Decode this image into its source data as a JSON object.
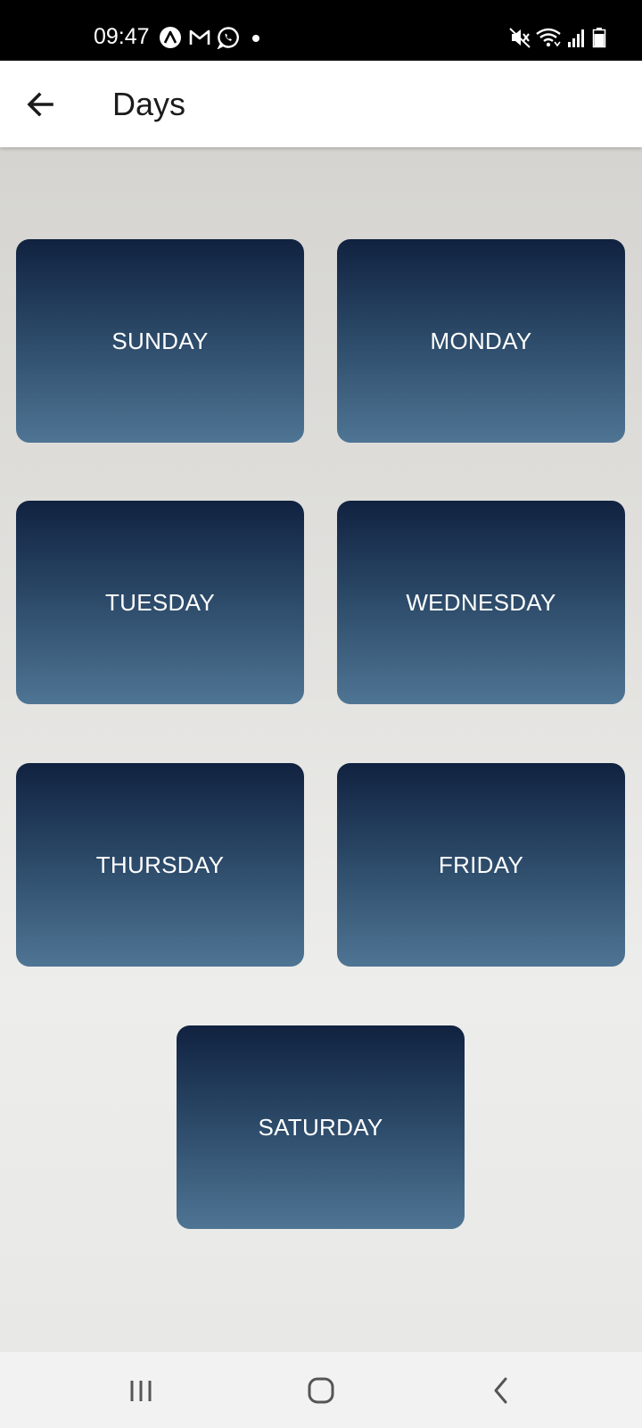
{
  "status_bar": {
    "time": "09:47",
    "icons": [
      "autopilot-icon",
      "gmail-icon",
      "whatsapp-icon",
      "notification-dot-icon",
      "mute-icon",
      "wifi-icon",
      "signal-icon",
      "battery-icon"
    ]
  },
  "app_bar": {
    "title": "Days",
    "back_icon": "arrow-back-icon"
  },
  "days": [
    {
      "label": "SUNDAY"
    },
    {
      "label": "MONDAY"
    },
    {
      "label": "TUESDAY"
    },
    {
      "label": "WEDNESDAY"
    },
    {
      "label": "THURSDAY"
    },
    {
      "label": "FRIDAY"
    },
    {
      "label": "SATURDAY"
    }
  ],
  "colors": {
    "card_top": "#102240",
    "card_bottom": "#4f7594",
    "background_top": "#d5d4d0",
    "background_bottom": "#e8e8e6",
    "app_bar": "#ffffff",
    "status_bar": "#000000"
  },
  "nav_bar": {
    "icons": [
      "recents-icon",
      "home-icon",
      "nav-back-icon"
    ]
  }
}
